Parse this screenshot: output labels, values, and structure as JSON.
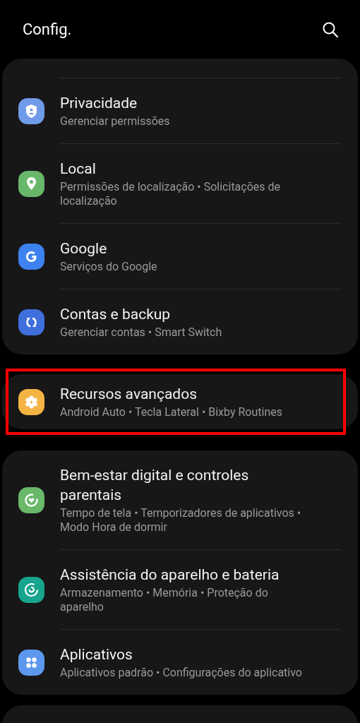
{
  "header": {
    "title": "Config."
  },
  "groups": [
    {
      "highlighted": false,
      "items": [
        {
          "kind": "shield",
          "color": "#6f9be8",
          "title": "Privacidade",
          "subtitle": "Gerenciar permissões"
        },
        {
          "kind": "pin",
          "color": "#69b76a",
          "title": "Local",
          "subtitle": "Permissões de localização • Solicitações de localização"
        },
        {
          "kind": "g",
          "color": "#3d82f0",
          "title": "Google",
          "subtitle": "Serviços do Google"
        },
        {
          "kind": "sync",
          "color": "#3f6fdc",
          "title": "Contas e backup",
          "subtitle": "Gerenciar contas • Smart Switch"
        }
      ]
    },
    {
      "highlighted": true,
      "items": [
        {
          "kind": "gear",
          "color": "#f4b444",
          "title": "Recursos avançados",
          "subtitle": "Android Auto • Tecla Lateral • Bixby Routines"
        }
      ]
    },
    {
      "highlighted": false,
      "items": [
        {
          "kind": "heart",
          "color": "#6ab86a",
          "title": "Bem-estar digital e controles parentais",
          "subtitle": "Tempo de tela • Temporizadores de aplicativos • Modo Hora de dormir"
        },
        {
          "kind": "care",
          "color": "#18a58e",
          "title": "Assistência do aparelho e bateria",
          "subtitle": "Armazenamento • Memória • Proteção do aparelho"
        },
        {
          "kind": "apps",
          "color": "#5c98ee",
          "title": "Aplicativos",
          "subtitle": "Aplicativos padrão • Configurações do aplicativo"
        }
      ]
    }
  ]
}
